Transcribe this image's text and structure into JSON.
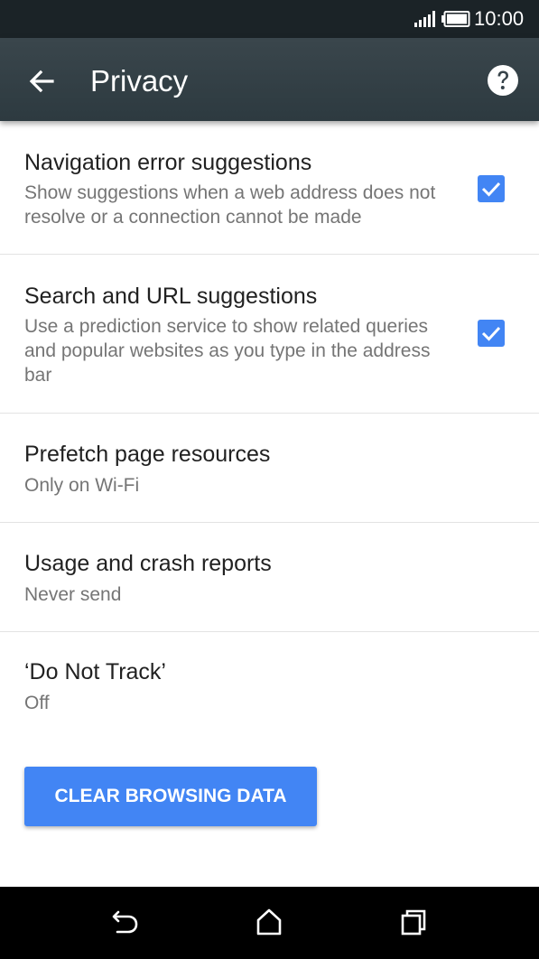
{
  "status_bar": {
    "time": "10:00",
    "icons": [
      "signal-icon",
      "battery-icon"
    ]
  },
  "app_bar": {
    "title": "Privacy",
    "icons": [
      "back-arrow-icon",
      "help-icon"
    ]
  },
  "preferences": [
    {
      "title": "Navigation error suggestions",
      "summary": "Show suggestions when a web address does not resolve or a connection cannot be made",
      "checked": true
    },
    {
      "title": "Search and URL suggestions",
      "summary": "Use a prediction service to show related queries and popular websites as you type in the address bar",
      "checked": true
    },
    {
      "title": "Prefetch page resources",
      "summary": "Only on Wi-Fi"
    },
    {
      "title": "Usage and crash reports",
      "summary": "Never send"
    },
    {
      "title": "‘Do Not Track’",
      "summary": "Off"
    }
  ],
  "clear_button": {
    "label": "CLEAR BROWSING DATA"
  },
  "colors": {
    "accent": "#4285f4",
    "app_bar": "#37434a",
    "status_bar": "#1b2327"
  },
  "nav_bar": {
    "icons": [
      "back-icon",
      "home-icon",
      "recents-icon"
    ]
  }
}
